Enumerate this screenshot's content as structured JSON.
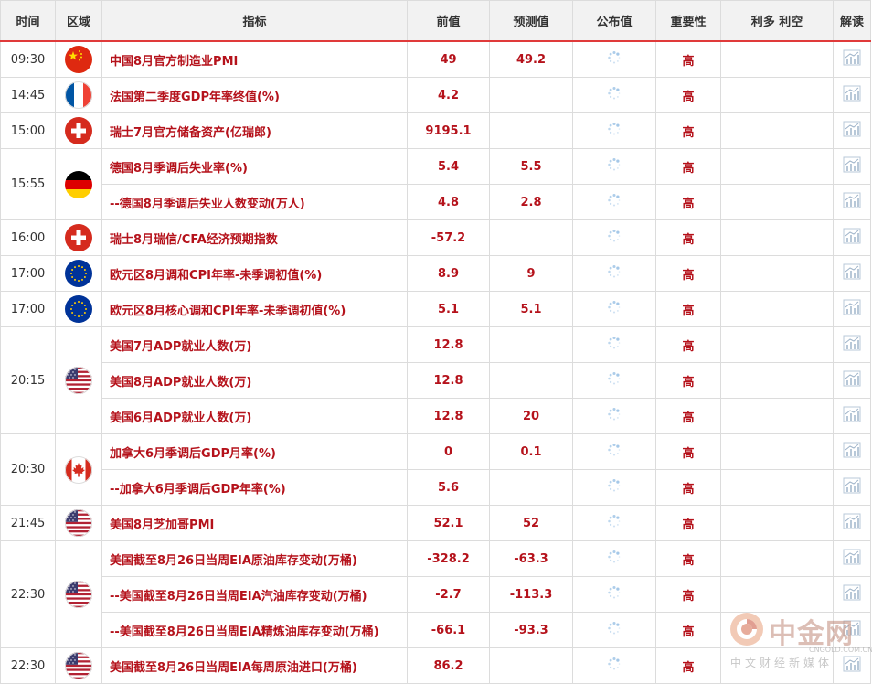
{
  "table": {
    "headers": {
      "time": "时间",
      "region": "区域",
      "indicator": "指标",
      "previous": "前值",
      "forecast": "预测值",
      "actual": "公布值",
      "importance": "重要性",
      "impact": "利多 利空",
      "analysis": "解读"
    },
    "groups": [
      {
        "time": "09:30",
        "flag": "china-flag-icon",
        "rows": [
          {
            "name": "中国8月官方制造业PMI",
            "prev": "49",
            "fcst": "49.2",
            "imp": "高"
          }
        ]
      },
      {
        "time": "14:45",
        "flag": "france-flag-icon",
        "rows": [
          {
            "name": "法国第二季度GDP年率终值(%)",
            "prev": "4.2",
            "fcst": "",
            "imp": "高"
          }
        ]
      },
      {
        "time": "15:00",
        "flag": "switzerland-flag-icon",
        "rows": [
          {
            "name": "瑞士7月官方储备资产(亿瑞郎)",
            "prev": "9195.1",
            "fcst": "",
            "imp": "高"
          }
        ]
      },
      {
        "time": "15:55",
        "flag": "germany-flag-icon",
        "rows": [
          {
            "name": "德国8月季调后失业率(%)",
            "prev": "5.4",
            "fcst": "5.5",
            "imp": "高"
          },
          {
            "name": "--德国8月季调后失业人数变动(万人)",
            "prev": "4.8",
            "fcst": "2.8",
            "imp": "高"
          }
        ]
      },
      {
        "time": "16:00",
        "flag": "switzerland-flag-icon",
        "rows": [
          {
            "name": "瑞士8月瑞信/CFA经济预期指数",
            "prev": "-57.2",
            "fcst": "",
            "imp": "高"
          }
        ]
      },
      {
        "time": "17:00",
        "flag": "eu-flag-icon",
        "rows": [
          {
            "name": "欧元区8月调和CPI年率-未季调初值(%)",
            "prev": "8.9",
            "fcst": "9",
            "imp": "高"
          }
        ]
      },
      {
        "time": "17:00",
        "flag": "eu-flag-icon",
        "rows": [
          {
            "name": "欧元区8月核心调和CPI年率-未季调初值(%)",
            "prev": "5.1",
            "fcst": "5.1",
            "imp": "高"
          }
        ]
      },
      {
        "time": "20:15",
        "flag": "usa-flag-icon",
        "rows": [
          {
            "name": "美国7月ADP就业人数(万)",
            "prev": "12.8",
            "fcst": "",
            "imp": "高"
          },
          {
            "name": "美国8月ADP就业人数(万)",
            "prev": "12.8",
            "fcst": "",
            "imp": "高"
          },
          {
            "name": "美国6月ADP就业人数(万)",
            "prev": "12.8",
            "fcst": "20",
            "imp": "高"
          }
        ]
      },
      {
        "time": "20:30",
        "flag": "canada-flag-icon",
        "rows": [
          {
            "name": "加拿大6月季调后GDP月率(%)",
            "prev": "0",
            "fcst": "0.1",
            "imp": "高"
          },
          {
            "name": "--加拿大6月季调后GDP年率(%)",
            "prev": "5.6",
            "fcst": "",
            "imp": "高"
          }
        ]
      },
      {
        "time": "21:45",
        "flag": "usa-flag-icon",
        "rows": [
          {
            "name": "美国8月芝加哥PMI",
            "prev": "52.1",
            "fcst": "52",
            "imp": "高"
          }
        ]
      },
      {
        "time": "22:30",
        "flag": "usa-flag-icon",
        "rows": [
          {
            "name": "美国截至8月26日当周EIA原油库存变动(万桶)",
            "prev": "-328.2",
            "fcst": "-63.3",
            "imp": "高"
          },
          {
            "name": "--美国截至8月26日当周EIA汽油库存变动(万桶)",
            "prev": "-2.7",
            "fcst": "-113.3",
            "imp": "高"
          },
          {
            "name": "--美国截至8月26日当周EIA精炼油库存变动(万桶)",
            "prev": "-66.1",
            "fcst": "-93.3",
            "imp": "高"
          }
        ]
      },
      {
        "time": "22:30",
        "flag": "usa-flag-icon",
        "rows": [
          {
            "name": "美国截至8月26日当周EIA每周原油进口(万桶)",
            "prev": "86.2",
            "fcst": "",
            "imp": "高"
          }
        ]
      }
    ]
  },
  "watermark": {
    "brand": "中金网",
    "domain": "CNGOLD.COM.CN",
    "slogan": "中文财经新媒体"
  },
  "colors": {
    "accent_red": "#b5121b",
    "header_border": "#e03a3a",
    "header_bg": "#f2f2f2"
  }
}
